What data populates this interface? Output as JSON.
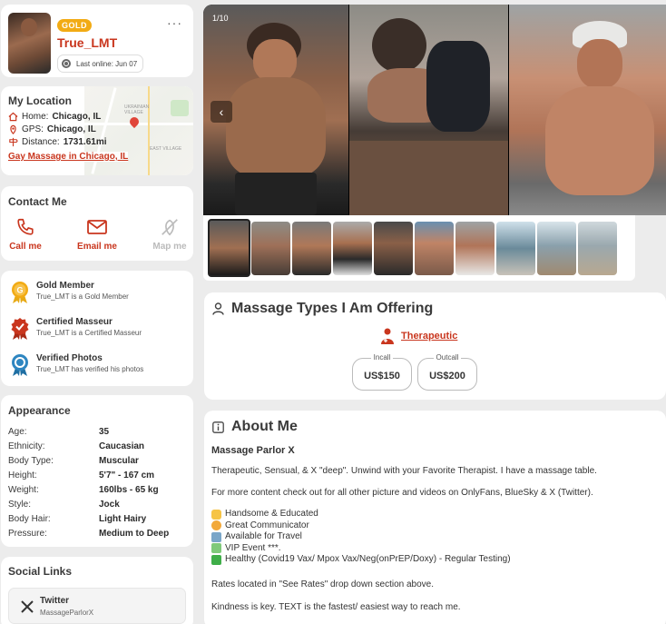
{
  "profile": {
    "badge": "GOLD",
    "username": "True_LMT",
    "last_online": "Last online: Jun 07",
    "menu": "···"
  },
  "location": {
    "title": "My Location",
    "home_label": "Home:",
    "home_value": "Chicago, IL",
    "gps_label": "GPS:",
    "gps_value": "Chicago, IL",
    "distance_label": "Distance:",
    "distance_value": "1731.61mi",
    "link": "Gay Massage in Chicago, IL",
    "map_labels": [
      "UKRAINIAN VILLAGE",
      "EAST VILLAGE"
    ]
  },
  "contact": {
    "title": "Contact Me",
    "items": [
      {
        "label": "Call me",
        "icon": "phone-icon",
        "enabled": true
      },
      {
        "label": "Email me",
        "icon": "mail-icon",
        "enabled": true
      },
      {
        "label": "Map me",
        "icon": "map-off-icon",
        "enabled": false
      }
    ]
  },
  "badges": [
    {
      "title": "Gold Member",
      "subtitle": "True_LMT is a Gold Member",
      "icon": "gold-medal-icon",
      "color": "#e7a915"
    },
    {
      "title": "Certified Masseur",
      "subtitle": "True_LMT is a Certified Masseur",
      "icon": "certified-medal-icon",
      "color": "#c9361e"
    },
    {
      "title": "Verified Photos",
      "subtitle": "True_LMT has verified his photos",
      "icon": "verified-medal-icon",
      "color": "#2e86c1"
    }
  ],
  "appearance": {
    "title": "Appearance",
    "rows": [
      {
        "k": "Age:",
        "v": "35"
      },
      {
        "k": "Ethnicity:",
        "v": "Caucasian"
      },
      {
        "k": "Body Type:",
        "v": "Muscular"
      },
      {
        "k": "Height:",
        "v": "5'7\" - 167 cm"
      },
      {
        "k": "Weight:",
        "v": "160lbs - 65 kg"
      },
      {
        "k": "Style:",
        "v": "Jock"
      },
      {
        "k": "Body Hair:",
        "v": "Light Hairy"
      },
      {
        "k": "Pressure:",
        "v": "Medium to Deep"
      }
    ]
  },
  "social": {
    "title": "Social Links",
    "items": [
      {
        "name": "Twitter",
        "handle": "MassageParlorX",
        "icon": "x-logo-icon"
      }
    ]
  },
  "gallery": {
    "counter": "1/10",
    "thumb_count": 10,
    "selected": 0
  },
  "massage": {
    "title": "Massage Types I Am Offering",
    "type": "Therapeutic",
    "incall_label": "Incall",
    "incall_value": "US$150",
    "outcall_label": "Outcall",
    "outcall_value": "US$200"
  },
  "about": {
    "title": "About Me",
    "subtitle": "Massage Parlor X",
    "p1": "Therapeutic, Sensual, & X \"deep\". Unwind with your Favorite Therapist. I have a massage table.",
    "p2": "For more content check out for all other picture and videos on OnlyFans, BlueSky & X (Twitter).",
    "list": [
      {
        "emoji": "raising-hands-icon",
        "text": "Handsome & Educated"
      },
      {
        "emoji": "smile-icon",
        "text": "Great Communicator"
      },
      {
        "emoji": "airplane-icon",
        "text": "Available for Travel"
      },
      {
        "emoji": "cocktail-icon",
        "text": "VIP Event ***."
      },
      {
        "emoji": "check-box-icon",
        "text": "Healthy (Covid19 Vax/ Mpox Vax/Neg(onPrEP/Doxy) - Regular Testing)"
      }
    ],
    "p3": "Rates located in \"See Rates\" drop down section above.",
    "p4": "Kindness is key. TEXT is the fastest/ easiest way to reach me."
  },
  "colors": {
    "accent": "#c9361e",
    "gold": "#f2ab14"
  }
}
